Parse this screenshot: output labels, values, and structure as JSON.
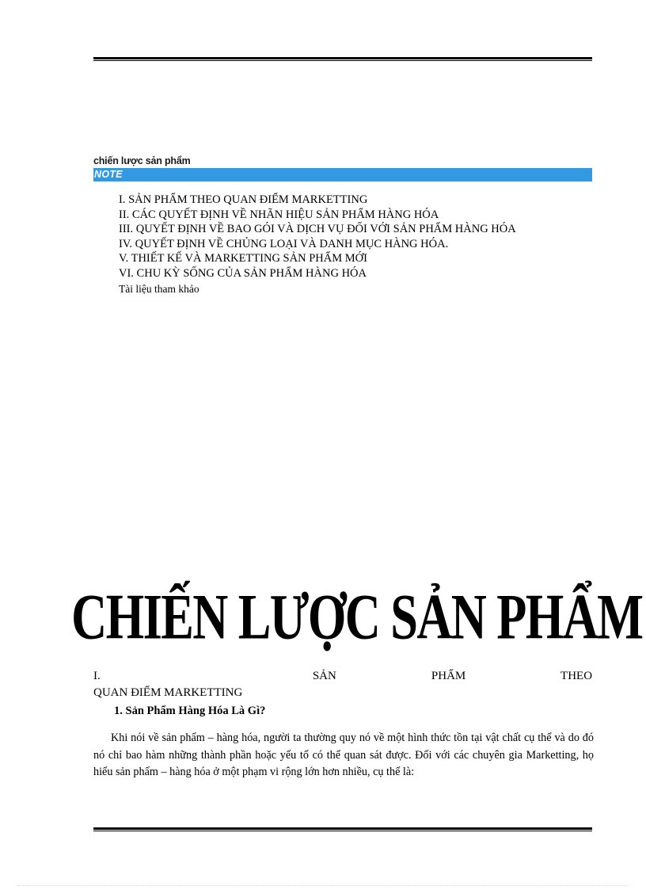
{
  "document": {
    "header": {
      "title": "chiến lược sản phẩm",
      "note_label": "NOTE",
      "note_bar_color": "#3399e0"
    },
    "toc": {
      "items": [
        "I. SẢN PHẨM THEO QUAN ĐIỂM MARKETTING",
        "II. CÁC QUYẾT ĐỊNH VỀ NHÃN HIỆU SẢN PHẨM HÀNG HÓA",
        "III. QUYẾT ĐỊNH VỀ BAO GÓI VÀ DỊCH VỤ ĐỐI VỚI SẢN PHẨM HÀNG HÓA",
        "IV. QUYẾT ĐỊNH VỀ CHỦNG LOẠI VÀ DANH MỤC HÀNG HÓA.",
        "V. THIẾT KẾ VÀ MARKETTING SẢN PHẨM MỚI",
        "VI. CHU KỲ SỐNG CỦA SẢN PHẨM HÀNG HÓA"
      ],
      "references_label": "Tài liệu tham khảo"
    },
    "title_art": {
      "text": "CHIẾN LƯỢC SẢN PHẨM"
    },
    "section": {
      "number": "I.",
      "heading_line1_words": [
        "SẢN",
        "PHẨM",
        "THEO"
      ],
      "heading_line2": "QUAN ĐIỂM MARKETTING",
      "sub_heading": "1. Sản Phẩm Hàng Hóa Là Gì?",
      "paragraph": "Khi nói về sản phẩm – hàng hóa, người ta thường quy nó về một hình thức tồn tại vật chất cụ thể và do đó nó chỉ bao hàm những thành phần hoặc yếu tố có thể quan sát được. Đối với các chuyên gia Marketting, họ hiểu sản phẩm – hàng hóa ở một phạm vi rộng lớn hơn nhiều, cụ thể là:"
    }
  }
}
